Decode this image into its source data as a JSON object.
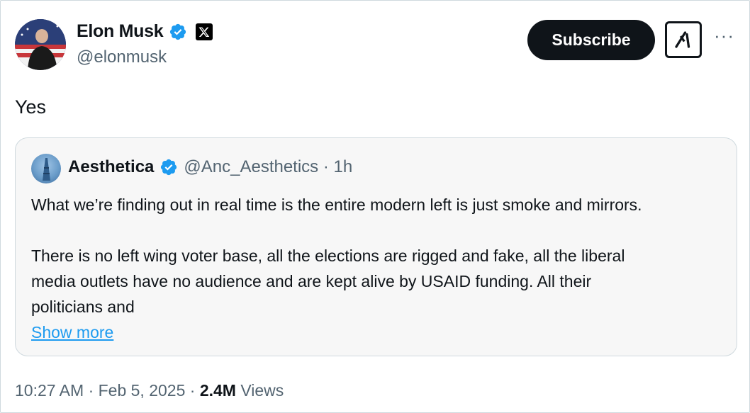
{
  "author": {
    "name": "Elon Musk",
    "handle": "@elonmusk"
  },
  "actions": {
    "subscribe_label": "Subscribe",
    "more_label": "···"
  },
  "tweet": {
    "text": "Yes"
  },
  "quoted": {
    "name": "Aesthetica",
    "handle_time": "@Anc_Aesthetics · 1h",
    "paragraph1": "What we’re finding out in real time is the entire modern left is just smoke and mirrors.",
    "paragraph2_line1": "There is no left wing voter base, all the elections are rigged and fake, all the liberal",
    "paragraph2_line2": "media outlets have no audience and are kept alive by USAID funding. All their",
    "paragraph2_line3": "politicians and",
    "show_more": "Show more"
  },
  "footer": {
    "timestamp": "10:27 AM · Feb 5, 2025 · ",
    "views_count": "2.4M",
    "views_label": " Views"
  },
  "colors": {
    "verified": "#1d9bf0",
    "link": "#1d9bf0",
    "muted": "#536471",
    "text": "#0f1419"
  },
  "icons": [
    "verified-badge-icon",
    "x-logo-icon",
    "grok-icon",
    "more-icon"
  ]
}
